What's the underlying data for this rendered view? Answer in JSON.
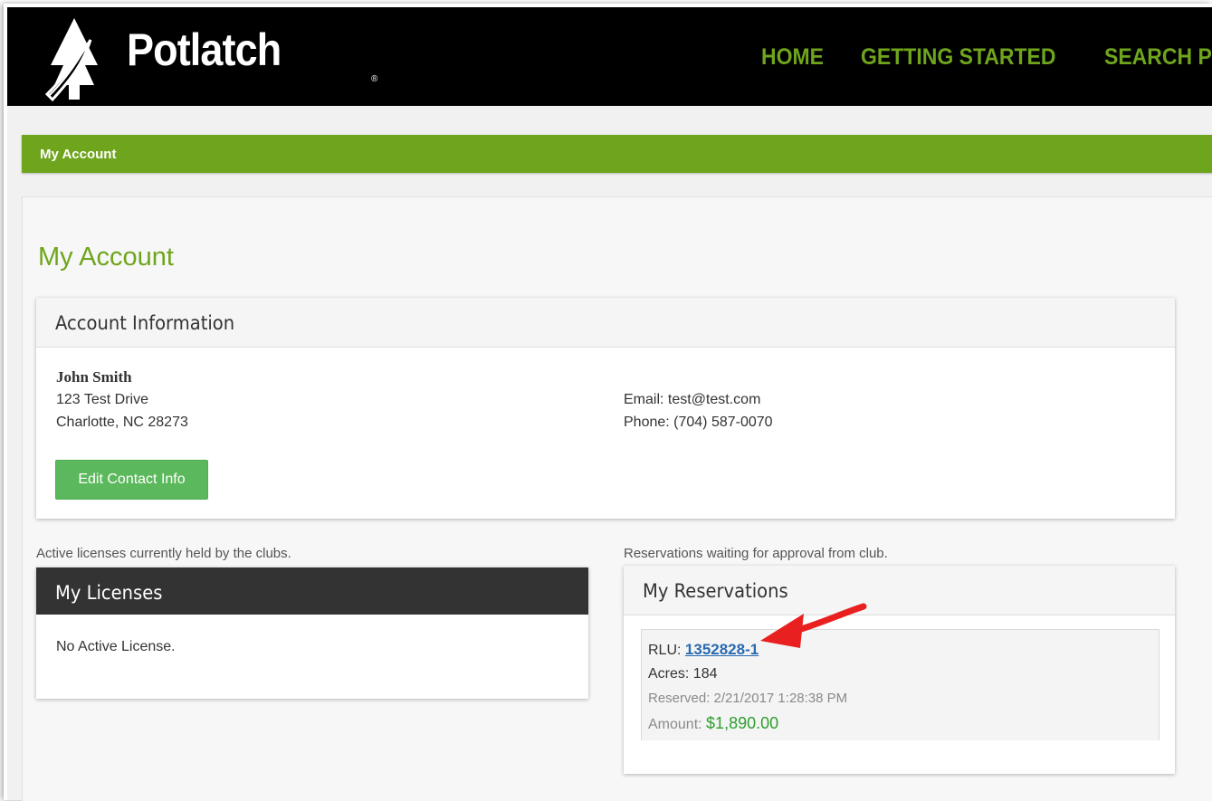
{
  "header": {
    "logo_text": "Potlatch",
    "logo_mark": "®",
    "nav": [
      "HOME",
      "GETTING STARTED",
      "SEARCH P"
    ]
  },
  "breadcrumb": "My Account",
  "page_title": "My Account",
  "account": {
    "heading": "Account Information",
    "name": "John Smith",
    "address1": "123 Test Drive",
    "address2": "Charlotte, NC 28273",
    "email": "Email: test@test.com",
    "phone": "Phone: (704) 587-0070",
    "edit_button": "Edit Contact Info"
  },
  "licenses": {
    "caption": "Active licenses currently held by the clubs.",
    "heading": "My Licenses",
    "empty": "No Active License."
  },
  "reservations": {
    "caption": "Reservations waiting for approval from club.",
    "heading": "My Reservations",
    "rlu_label": "RLU:",
    "rlu_value": "1352828-1",
    "acres": "Acres: 184",
    "reserved": "Reserved: 2/21/2017 1:28:38 PM",
    "amount_label": "Amount:",
    "amount_value": "$1,890.00"
  },
  "colors": {
    "brand_green": "#6fa51c",
    "button_green": "#5cb85c",
    "link_blue": "#2a6ab0",
    "amount_green": "#2e9e2e",
    "annotation_red": "#e82020"
  },
  "icons": {
    "logo": "tree-leaf-logo-icon",
    "annotation": "red-arrow-icon"
  }
}
